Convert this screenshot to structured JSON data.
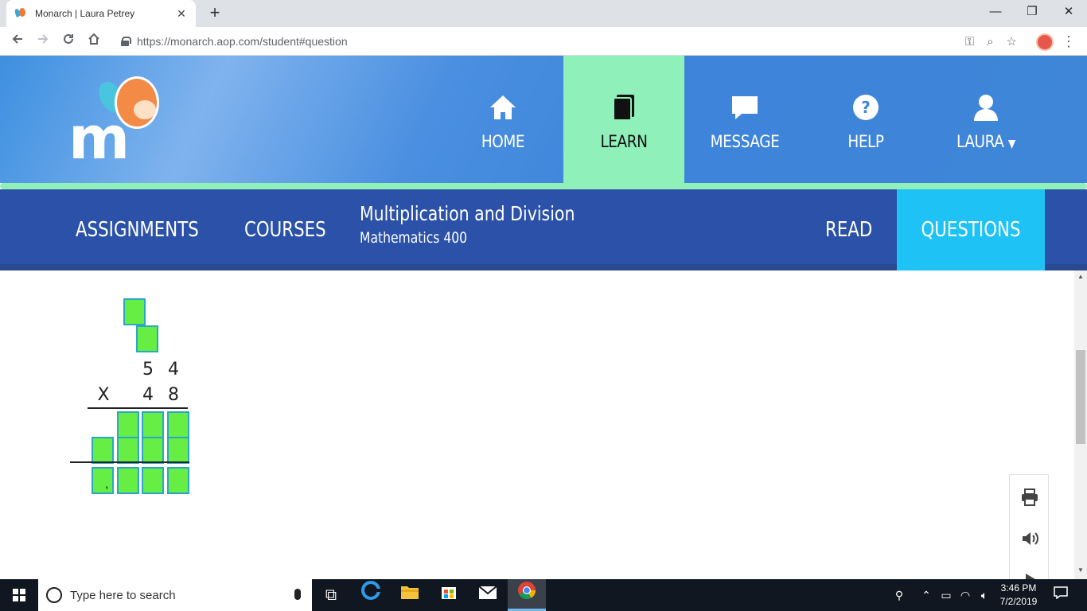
{
  "browser": {
    "tab_title": "Monarch | Laura Petrey",
    "tab_close": "✕",
    "new_tab": "+",
    "url": "https://monarch.aop.com/student#question",
    "window_controls": {
      "minimize": "—",
      "maximize": "❐",
      "close": "✕"
    }
  },
  "monarch_nav": {
    "items": [
      {
        "label": "HOME",
        "icon": "home-icon"
      },
      {
        "label": "LEARN",
        "icon": "book-icon",
        "active": true
      },
      {
        "label": "MESSAGE",
        "icon": "speech-bubble-icon"
      },
      {
        "label": "HELP",
        "icon": "question-circle-icon"
      },
      {
        "label": "LAURA",
        "icon": "user-icon"
      }
    ],
    "accent_color": "#8ff0b9"
  },
  "subnav": {
    "assignments": "ASSIGNMENTS",
    "courses": "COURSES",
    "course_title": "Multiplication and Division",
    "course_subtitle": "Mathematics 400",
    "read": "READ",
    "questions": "QUESTIONS"
  },
  "problem": {
    "multiplicand_digits": [
      "5",
      "4"
    ],
    "multiplier_sign": "X",
    "multiplier_digits": [
      "4",
      "8"
    ],
    "answer_comma": ","
  },
  "taskbar": {
    "search_placeholder": "Type here to search",
    "time": "3:46 PM",
    "date": "7/2/2019"
  }
}
